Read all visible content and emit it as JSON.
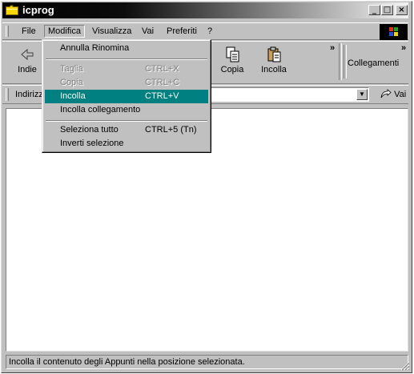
{
  "window": {
    "title": "icprog",
    "buttons": {
      "minimize": "_",
      "maximize": "□",
      "close": "×"
    }
  },
  "menubar": {
    "items": [
      "File",
      "Modifica",
      "Visualizza",
      "Vai",
      "Preferiti",
      "?"
    ],
    "open_item": "Modifica"
  },
  "toolbar": {
    "back_label": "Indie",
    "copy_label": "Copia",
    "paste_label": "Incolla",
    "more_chevron": "»",
    "links_label": "Collegamenti",
    "links_chevron": "»"
  },
  "addressbar": {
    "label": "Indirizz",
    "value": "",
    "go_label": "Vai"
  },
  "edit_menu": {
    "items": [
      {
        "label": "Annulla Rinomina",
        "shortcut": "",
        "state": "enabled"
      },
      {
        "label": "Taglia",
        "shortcut": "CTRL+X",
        "state": "disabled"
      },
      {
        "label": "Copia",
        "shortcut": "CTRL+C",
        "state": "disabled"
      },
      {
        "label": "Incolla",
        "shortcut": "CTRL+V",
        "state": "highlighted"
      },
      {
        "label": "Incolla collegamento",
        "shortcut": "",
        "state": "enabled"
      },
      {
        "label": "Seleziona tutto",
        "shortcut": "CTRL+5 (Tn)",
        "state": "enabled"
      },
      {
        "label": "Inverti selezione",
        "shortcut": "",
        "state": "enabled"
      }
    ]
  },
  "status": {
    "text": "Incolla il contenuto degli Appunti nella posizione selezionata."
  },
  "colors": {
    "highlight": "#008080",
    "face": "#c0c0c0"
  }
}
